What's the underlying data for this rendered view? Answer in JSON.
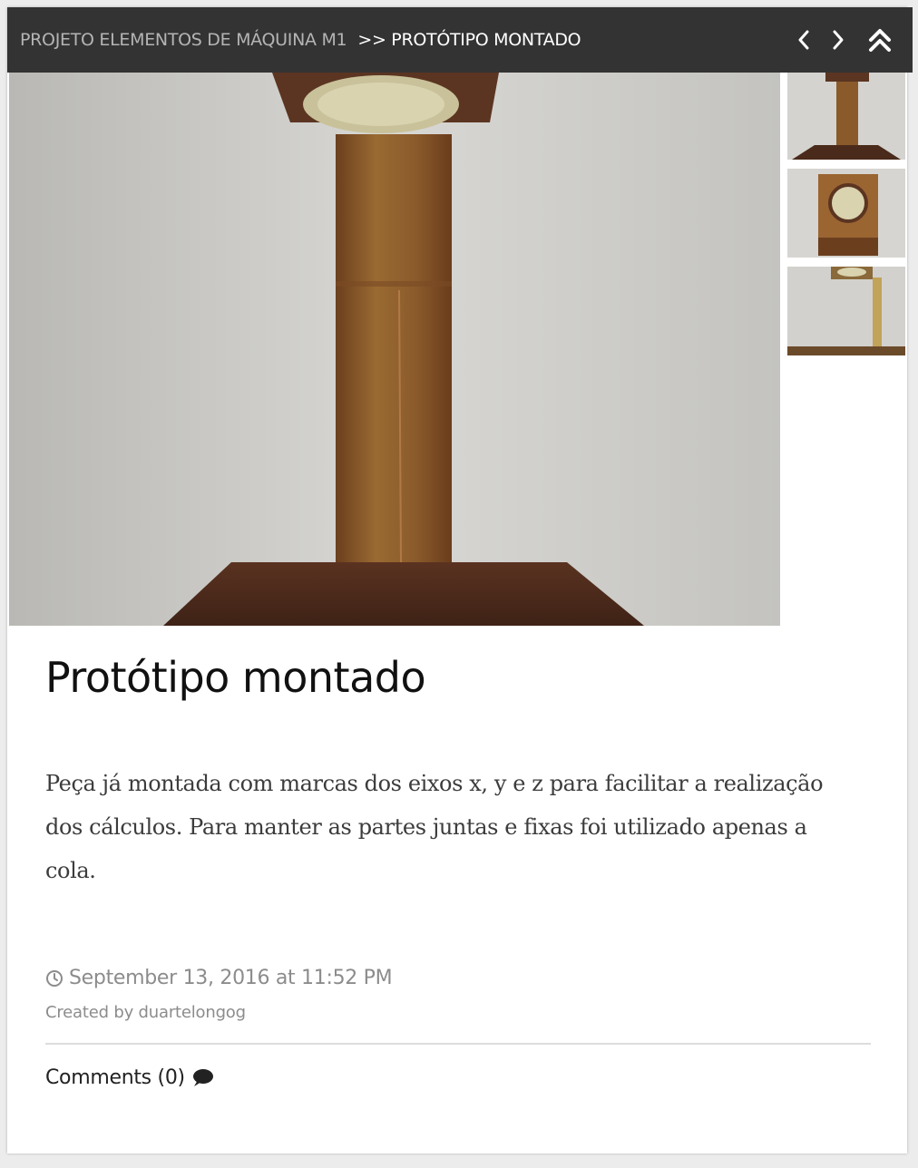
{
  "breadcrumb": {
    "parent": "PROJETO ELEMENTOS DE MÁQUINA M1",
    "current": ">> PROTÓTIPO MONTADO"
  },
  "nav": {
    "prev_icon": "chevron-left-icon",
    "next_icon": "chevron-right-icon",
    "top_icon": "double-chevron-up-icon"
  },
  "post": {
    "title": "Protótipo montado",
    "description": "Peça já montada com marcas dos eixos x, y e z para facilitar a realização dos cálculos. Para manter as partes juntas e fixas foi utilizado apenas a cola.",
    "date": "September 13, 2016 at 11:52 PM",
    "author": "Created by duartelongog",
    "comments": "Comments (0)"
  },
  "colors": {
    "topbar": "#333333",
    "crumb_parent": "#b4b4b4",
    "crumb_current": "#ffffff",
    "meta": "#8c8c8c",
    "title": "#111111",
    "wood": "#8a5a2b"
  }
}
